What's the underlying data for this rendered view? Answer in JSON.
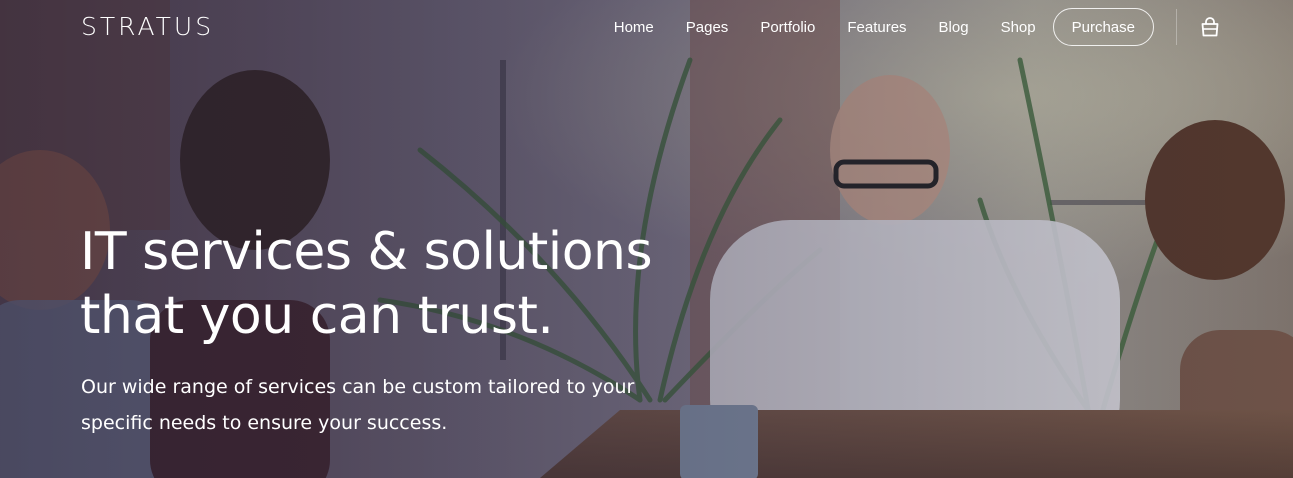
{
  "brand": {
    "logo_text": "STRATUS"
  },
  "nav": {
    "items": [
      {
        "label": "Home"
      },
      {
        "label": "Pages"
      },
      {
        "label": "Portfolio"
      },
      {
        "label": "Features"
      },
      {
        "label": "Blog"
      },
      {
        "label": "Shop"
      }
    ],
    "purchase_label": "Purchase",
    "cart_icon": "shopping-bag-icon"
  },
  "hero": {
    "headline_line1": "IT services & solutions",
    "headline_line2": "that you can trust.",
    "subtext_line1": "Our wide range of services can be custom tailored to your",
    "subtext_line2": "specific needs to ensure your success.",
    "background": "office-meeting-photo"
  },
  "colors": {
    "text": "#ffffff",
    "overlay": "#2a2438"
  }
}
